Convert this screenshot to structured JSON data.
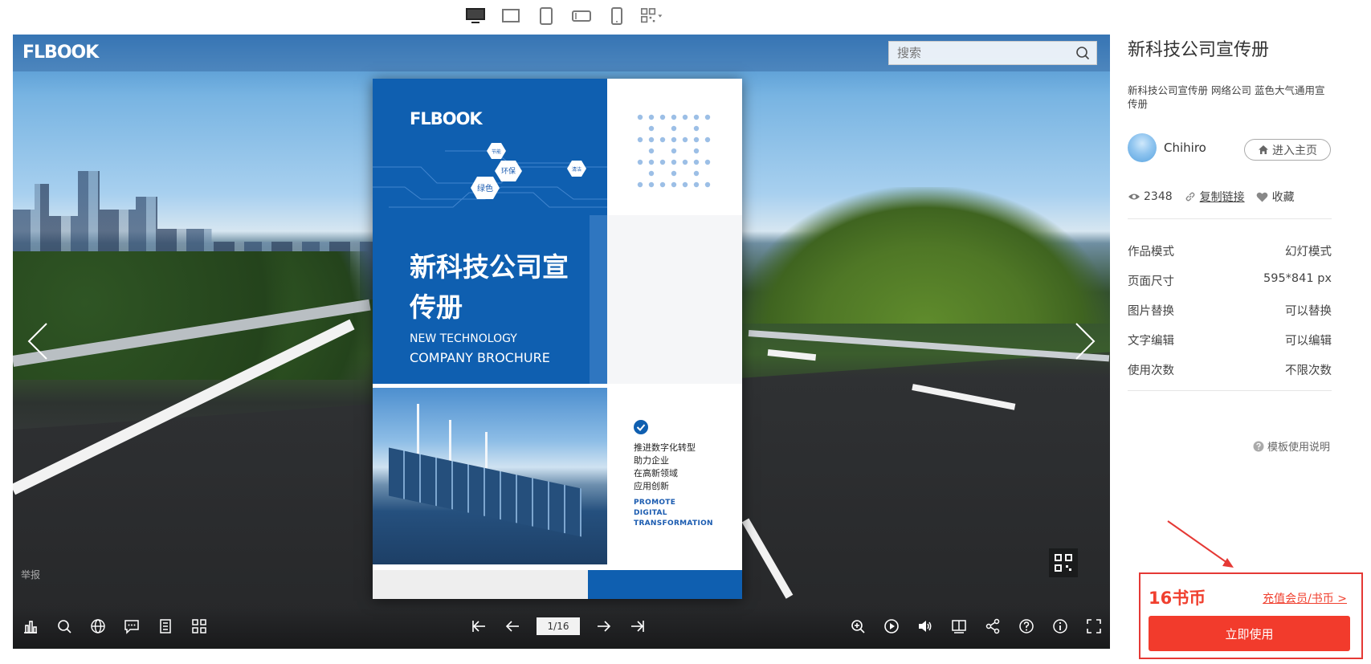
{
  "viewer": {
    "logo": "FLBOOK",
    "search_placeholder": "搜索",
    "report_label": "举报",
    "page_indicator": "1/16"
  },
  "brochure": {
    "logo": "FLBOOK",
    "title_cn": "新科技公司宣传册",
    "title_en_1": "NEW TECHNOLOGY",
    "title_en_2": "COMPANY BROCHURE",
    "tags": [
      "绿色",
      "环保",
      "清洁",
      "节能"
    ],
    "body_cn": [
      "推进数字化转型",
      "助力企业",
      "在高新领域",
      "应用创新"
    ],
    "body_en": [
      "PROMOTE",
      "DIGITAL",
      "TRANSFORMATION"
    ]
  },
  "sidebar": {
    "title": "新科技公司宣传册",
    "description": "新科技公司宣传册 网络公司 蓝色大气通用宣传册",
    "author": "Chihiro",
    "home_button": "进入主页",
    "views": "2348",
    "copy_link": "复制链接",
    "favorite": "收藏",
    "specs": [
      {
        "label": "作品模式",
        "value": "幻灯模式"
      },
      {
        "label": "页面尺寸",
        "value": "595*841 px"
      },
      {
        "label": "图片替换",
        "value": "可以替换"
      },
      {
        "label": "文字编辑",
        "value": "可以编辑"
      },
      {
        "label": "使用次数",
        "value": "不限次数"
      }
    ],
    "help_label": "模板使用说明",
    "price": "16书币",
    "recharge_link": "充值会员/书币 >",
    "use_button": "立即使用"
  },
  "colors": {
    "brand_blue": "#0f5fb0",
    "accent_red": "#f23b2c",
    "link_red": "#f0402f"
  }
}
